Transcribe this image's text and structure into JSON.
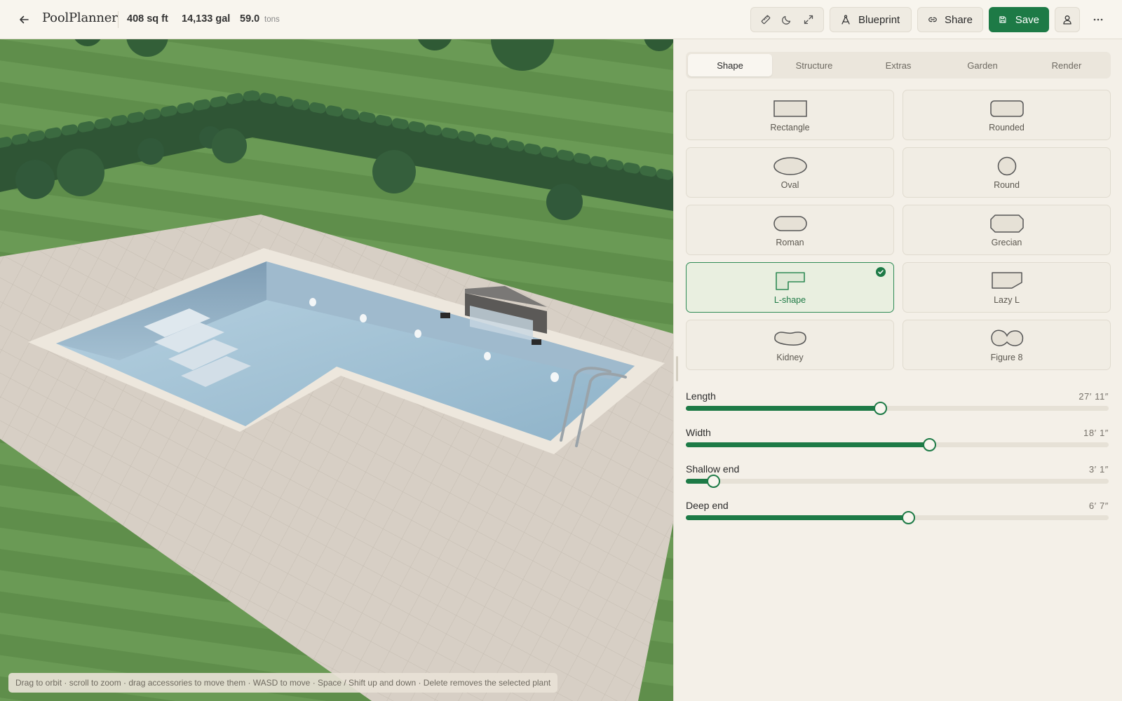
{
  "app": {
    "brand": "PoolPlanner",
    "stats": {
      "area": "408 sq ft",
      "volume": "14,133 gal",
      "weight_value": "59.0",
      "weight_unit": "tons"
    }
  },
  "toolbar": {
    "tools": [
      "ruler-icon",
      "moon-icon",
      "expand-icon"
    ],
    "blueprint_label": "Blueprint",
    "share_label": "Share",
    "save_label": "Save"
  },
  "viewport": {
    "hint": "Drag to orbit · scroll to zoom · drag accessories to move them · WASD to move · Space / Shift up and down · Delete removes the selected plant"
  },
  "panel": {
    "tabs": [
      {
        "label": "Shape",
        "active": true
      },
      {
        "label": "Structure",
        "active": false
      },
      {
        "label": "Extras",
        "active": false
      },
      {
        "label": "Garden",
        "active": false
      },
      {
        "label": "Render",
        "active": false
      }
    ],
    "shapes": [
      {
        "label": "Rectangle",
        "icon": "rectangle-shape-icon",
        "selected": false
      },
      {
        "label": "Rounded",
        "icon": "rounded-shape-icon",
        "selected": false
      },
      {
        "label": "Oval",
        "icon": "oval-shape-icon",
        "selected": false
      },
      {
        "label": "Round",
        "icon": "round-shape-icon",
        "selected": false
      },
      {
        "label": "Roman",
        "icon": "roman-shape-icon",
        "selected": false
      },
      {
        "label": "Grecian",
        "icon": "grecian-shape-icon",
        "selected": false
      },
      {
        "label": "L-shape",
        "icon": "l-shape-icon",
        "selected": true
      },
      {
        "label": "Lazy L",
        "icon": "lazy-l-shape-icon",
        "selected": false
      },
      {
        "label": "Kidney",
        "icon": "kidney-shape-icon",
        "selected": false
      },
      {
        "label": "Figure 8",
        "icon": "figure-8-shape-icon",
        "selected": false
      }
    ],
    "sliders": [
      {
        "label": "Length",
        "value": "27′ 11″",
        "fraction": 0.46
      },
      {
        "label": "Width",
        "value": "18′ 1″",
        "fraction": 0.575
      },
      {
        "label": "Shallow end",
        "value": "3′ 1″",
        "fraction": 0.065
      },
      {
        "label": "Deep end",
        "value": "6′ 7″",
        "fraction": 0.525
      }
    ]
  },
  "colors": {
    "accent": "#1d7a46",
    "panel_bg": "#f4f0e8",
    "grass": "#5d8a4a",
    "water": "#a9c6d8"
  }
}
